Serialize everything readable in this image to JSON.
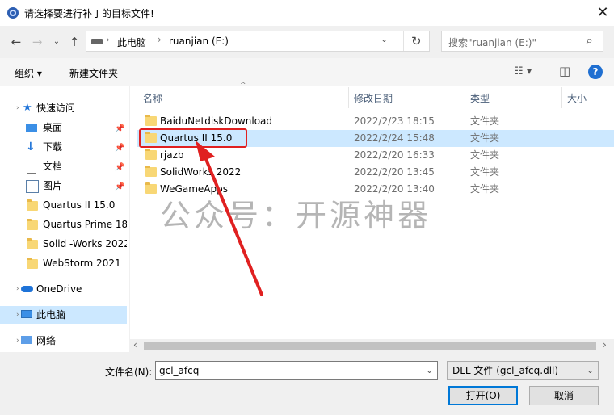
{
  "window": {
    "title": "请选择要进行补丁的目标文件!",
    "close_glyph": "✕"
  },
  "nav": {
    "back_glyph": "←",
    "forward_glyph": "→",
    "up_glyph": "↑",
    "breadcrumb": [
      "此电脑",
      "ruanjian (E:)"
    ],
    "separator": "›",
    "dropdown_glyph": "⌄",
    "refresh_glyph": "↻",
    "search_placeholder": "搜索\"ruanjian (E:)\"",
    "search_glyph": "⌕"
  },
  "toolbar": {
    "organize": "组织 ▾",
    "new_folder": "新建文件夹",
    "view_glyph": "☷ ▾",
    "pane_glyph": "◫",
    "help_glyph": "?"
  },
  "sidebar": {
    "items": [
      {
        "label": "快速访问",
        "icon": "star-icon"
      },
      {
        "label": "桌面",
        "icon": "desktop-icon",
        "pin": "📌"
      },
      {
        "label": "下载",
        "icon": "download-icon",
        "pin": "📌"
      },
      {
        "label": "文档",
        "icon": "document-icon",
        "pin": "📌"
      },
      {
        "label": "图片",
        "icon": "picture-icon",
        "pin": "📌"
      },
      {
        "label": "Quartus II 15.0",
        "icon": "folder-icon"
      },
      {
        "label": "Quartus Prime 18.",
        "icon": "folder-icon"
      },
      {
        "label": "Solid -Works 2022",
        "icon": "folder-icon"
      },
      {
        "label": "WebStorm 2021",
        "icon": "folder-icon"
      },
      {
        "label": "OneDrive",
        "icon": "cloud-icon"
      },
      {
        "label": "此电脑",
        "icon": "computer-icon"
      },
      {
        "label": "网络",
        "icon": "network-icon"
      }
    ]
  },
  "columns": {
    "name": "名称",
    "modified": "修改日期",
    "type": "类型",
    "size": "大小",
    "sort_glyph": "^"
  },
  "files": [
    {
      "name": "BaiduNetdiskDownload",
      "modified": "2022/2/23 18:15",
      "type": "文件夹"
    },
    {
      "name": "Quartus II 15.0",
      "modified": "2022/2/24 15:48",
      "type": "文件夹"
    },
    {
      "name": "rjazb",
      "modified": "2022/2/20 16:33",
      "type": "文件夹"
    },
    {
      "name": "SolidWorks 2022",
      "modified": "2022/2/20 13:45",
      "type": "文件夹"
    },
    {
      "name": "WeGameApps",
      "modified": "2022/2/20 13:40",
      "type": "文件夹"
    }
  ],
  "watermark": "公众号：开源神器",
  "scrollbar": {
    "left_glyph": "‹",
    "right_glyph": "›"
  },
  "footer": {
    "filename_label": "文件名(N):",
    "filename_value": "gcl_afcq",
    "filetype_value": "DLL 文件 (gcl_afcq.dll)",
    "open_label": "打开(O)",
    "cancel_label": "取消"
  },
  "colors": {
    "selection": "#cce8ff",
    "highlight_box": "#e02020",
    "accent": "#0078d7"
  }
}
